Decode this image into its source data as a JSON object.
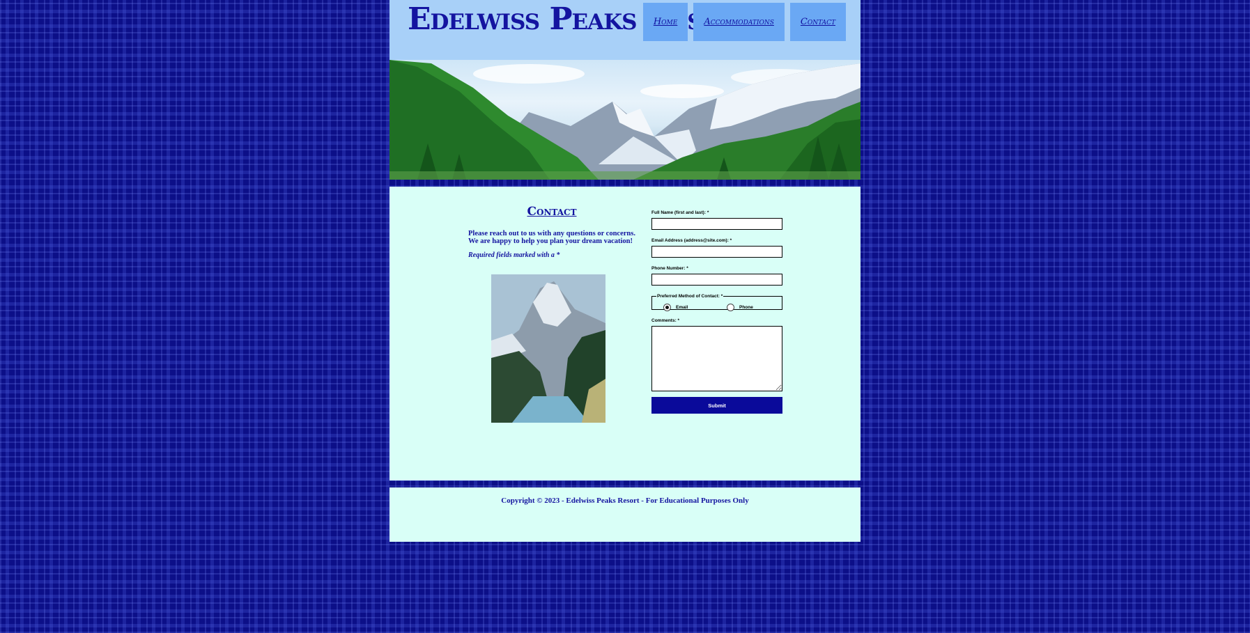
{
  "site": {
    "title": "Edelwiss Peaks Resort"
  },
  "nav": {
    "items": [
      "Home",
      "Accommodations",
      "Contact"
    ]
  },
  "main": {
    "heading": "Contact",
    "intro": "Please reach out to us with any questions or concerns. We are happy to help you plan your dream vacation!",
    "required_note": "Required fields marked with a *"
  },
  "form": {
    "name_label": "Full Name (first and last): *",
    "email_label": "Email Address (address@site.com): *",
    "phone_label": "Phone Number: *",
    "contact_legend": "Preferred Method of Contact: *",
    "contact_options": [
      "Email",
      "Phone"
    ],
    "selected_contact": "Email",
    "comments_label": "Comments: *",
    "submit_label": "Submit"
  },
  "footer": {
    "text": "Copyright © 2023 - Edelwiss Peaks Resort - For Educational Purposes Only"
  },
  "colors": {
    "background": "#0c0f88",
    "header": "#a8d0f8",
    "nav_button": "#6aa8f4",
    "content": "#d9fff7",
    "text": "#1414a0",
    "submit": "#0a0a9a"
  }
}
